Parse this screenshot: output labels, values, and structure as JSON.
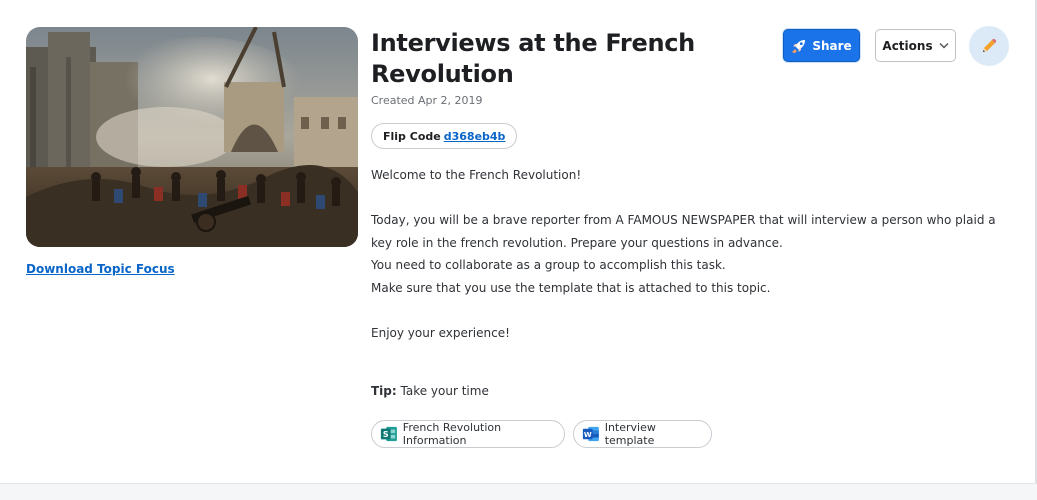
{
  "topic": {
    "title": "Interviews at the French Revolution",
    "created": "Created Apr 2, 2019",
    "image_alt": "Storming of the Bastille painting",
    "download_label": "Download Topic Focus"
  },
  "flip_code": {
    "label": "Flip Code",
    "code": "d368eb4b"
  },
  "header_actions": {
    "share_label": "Share",
    "actions_label": "Actions",
    "share_icon": "rocket-icon",
    "actions_icon": "chevron-down-icon",
    "edit_icon": "pencil-icon"
  },
  "description": {
    "line1": "Welcome to the French Revolution!",
    "line2": "Today, you will be a brave reporter from A FAMOUS NEWSPAPER that will interview a person who plaid a key role in the french revolution. Prepare your questions in advance.",
    "line3": "You need to collaborate as a group to accomplish this task.",
    "line4": "Make sure that you use the template that is attached to this topic.",
    "line5": "Enjoy your experience!",
    "tip_label": "Tip:",
    "tip_text": " Take your time"
  },
  "attachments": [
    {
      "label": "French Revolution Information",
      "icon": "sway-icon",
      "color": "#168c87"
    },
    {
      "label": "Interview template",
      "icon": "word-icon",
      "color": "#2b5cbd"
    }
  ],
  "colors": {
    "accent": "#1a73e8",
    "link": "#0a65c9",
    "edit_bg": "#dceaf7"
  }
}
